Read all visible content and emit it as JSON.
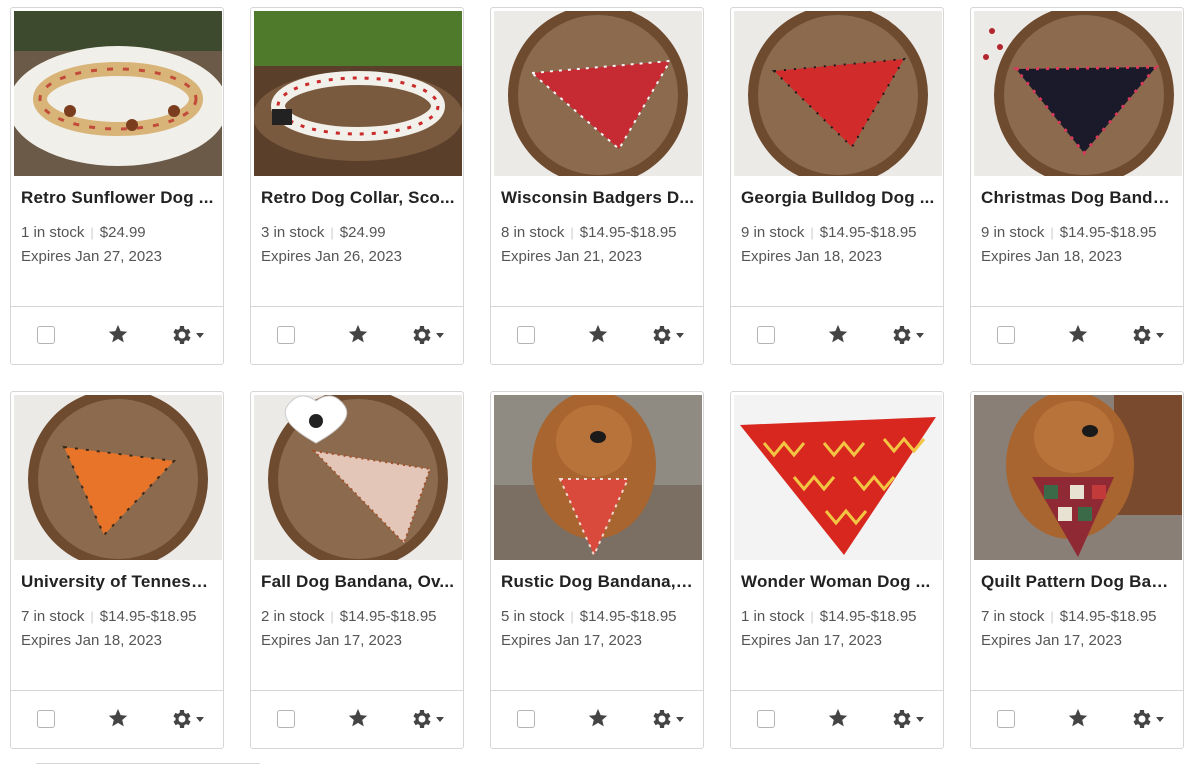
{
  "listings": [
    {
      "title": "Retro Sunflower Dog Collar, Retro Sunflower",
      "title_display": "Retro Sunflower Dog ...",
      "stock": "1 in stock",
      "price": "$24.99",
      "expires": "Expires Jan 27, 2023"
    },
    {
      "title": "Retro Dog Collar, Scottie",
      "title_display": "Retro Dog Collar, Sco...",
      "stock": "3 in stock",
      "price": "$24.99",
      "expires": "Expires Jan 26, 2023"
    },
    {
      "title": "Wisconsin Badgers Dog Bandana",
      "title_display": "Wisconsin Badgers D...",
      "stock": "8 in stock",
      "price": "$14.95-$18.95",
      "expires": "Expires Jan 21, 2023"
    },
    {
      "title": "Georgia Bulldog Dog Bandana",
      "title_display": "Georgia Bulldog Dog ...",
      "stock": "9 in stock",
      "price": "$14.95-$18.95",
      "expires": "Expires Jan 18, 2023"
    },
    {
      "title": "Christmas Dog Bandana",
      "title_display": "Christmas Dog Banda...",
      "stock": "9 in stock",
      "price": "$14.95-$18.95",
      "expires": "Expires Jan 18, 2023"
    },
    {
      "title": "University of Tennessee Dog Bandana",
      "title_display": "University of Tenness...",
      "stock": "7 in stock",
      "price": "$14.95-$18.95",
      "expires": "Expires Jan 18, 2023"
    },
    {
      "title": "Fall Dog Bandana, Over the Collar",
      "title_display": "Fall Dog Bandana, Ov...",
      "stock": "2 in stock",
      "price": "$14.95-$18.95",
      "expires": "Expires Jan 17, 2023"
    },
    {
      "title": "Rustic Dog Bandana, Over the Collar",
      "title_display": "Rustic Dog Bandana, ...",
      "stock": "5 in stock",
      "price": "$14.95-$18.95",
      "expires": "Expires Jan 17, 2023"
    },
    {
      "title": "Wonder Woman Dog Bandana",
      "title_display": "Wonder Woman Dog ...",
      "stock": "1 in stock",
      "price": "$14.95-$18.95",
      "expires": "Expires Jan 17, 2023"
    },
    {
      "title": "Quilt Pattern Dog Bandana",
      "title_display": "Quilt Pattern Dog Ban...",
      "stock": "7 in stock",
      "price": "$14.95-$18.95",
      "expires": "Expires Jan 17, 2023"
    }
  ],
  "colors": {
    "border": "#d6d6d6",
    "icon": "#444444",
    "text": "#222222",
    "meta": "#555555"
  },
  "icons": {
    "select": "checkbox",
    "feature": "star-icon",
    "settings": "gear-icon",
    "menu": "caret-down-icon"
  }
}
